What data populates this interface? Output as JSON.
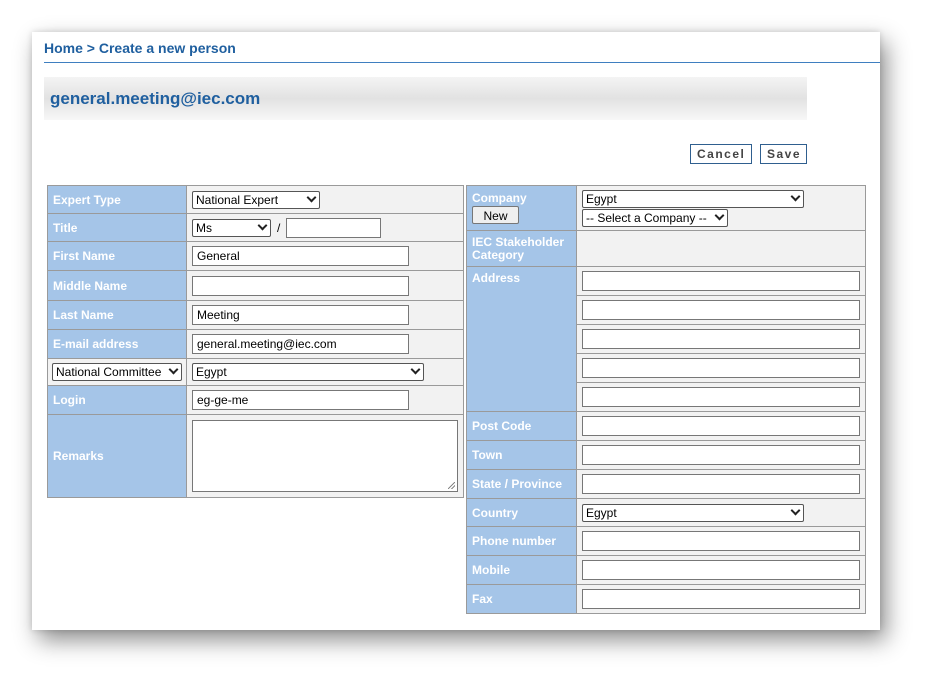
{
  "breadcrumb": {
    "home": "Home",
    "separator": " > ",
    "current": "Create a new person"
  },
  "header": {
    "title": "general.meeting@iec.com"
  },
  "actions": {
    "cancel": "Cancel",
    "save": "Save"
  },
  "left_form": {
    "expert_type": {
      "label": "Expert Type",
      "value": "National Expert"
    },
    "title": {
      "label": "Title",
      "value": "Ms",
      "separator": "/",
      "extra": ""
    },
    "first_name": {
      "label": "First Name",
      "value": "General"
    },
    "middle_name": {
      "label": "Middle Name",
      "value": ""
    },
    "last_name": {
      "label": "Last Name",
      "value": "Meeting"
    },
    "email": {
      "label": "E-mail address",
      "value": "general.meeting@iec.com"
    },
    "committee": {
      "type_value": "National Committee",
      "value": "Egypt"
    },
    "login": {
      "label": "Login",
      "value": "eg-ge-me"
    },
    "remarks": {
      "label": "Remarks",
      "value": ""
    }
  },
  "right_form": {
    "company": {
      "label": "Company",
      "new_button": "New",
      "country_value": "Egypt",
      "company_value": "-- Select a Company --"
    },
    "stakeholder": {
      "label": "IEC Stakeholder Category",
      "value": ""
    },
    "address": {
      "label": "Address",
      "lines": [
        "",
        "",
        "",
        "",
        ""
      ]
    },
    "post_code": {
      "label": "Post Code",
      "value": ""
    },
    "town": {
      "label": "Town",
      "value": ""
    },
    "state": {
      "label": "State / Province",
      "value": ""
    },
    "country": {
      "label": "Country",
      "value": "Egypt"
    },
    "phone": {
      "label": "Phone number",
      "value": ""
    },
    "mobile": {
      "label": "Mobile",
      "value": ""
    },
    "fax": {
      "label": "Fax",
      "value": ""
    }
  },
  "colors": {
    "label_bg": "#a5c5e8",
    "link_blue": "#1f5f9f",
    "value_bg": "#f2f2f2"
  }
}
